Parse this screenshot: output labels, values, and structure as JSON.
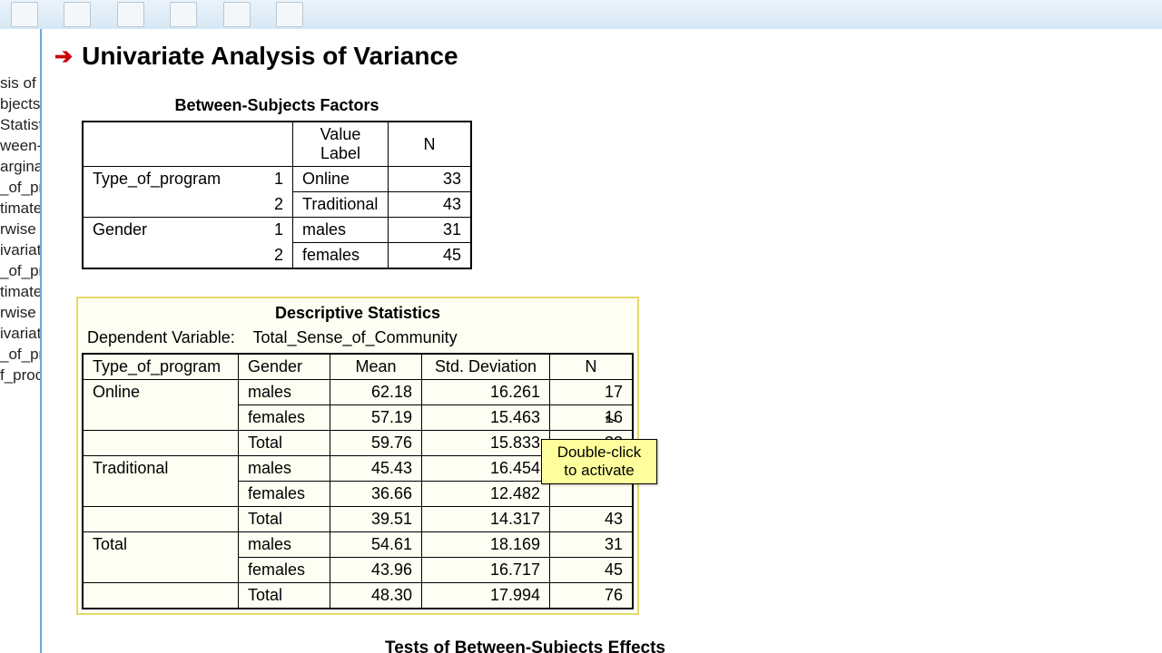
{
  "title": "Univariate Analysis of Variance",
  "outline_items": [
    "sis of V",
    "",
    "",
    "bjects",
    "Statisti",
    "ween-",
    "arginal",
    "",
    "_of_pr",
    "",
    "timate",
    "rwise",
    "ivariat",
    "_of_pr",
    "",
    "timate",
    "rwise",
    "ivariat",
    "_of_pr",
    "",
    "f_proc"
  ],
  "factors": {
    "caption": "Between-Subjects Factors",
    "headers": {
      "value_label": "Value Label",
      "n": "N"
    },
    "rows": [
      {
        "factor": "Type_of_program",
        "level": "1",
        "label": "Online",
        "n": "33"
      },
      {
        "factor": "",
        "level": "2",
        "label": "Traditional",
        "n": "43"
      },
      {
        "factor": "Gender",
        "level": "1",
        "label": "males",
        "n": "31"
      },
      {
        "factor": "",
        "level": "2",
        "label": "females",
        "n": "45"
      }
    ]
  },
  "descriptives": {
    "caption": "Descriptive Statistics",
    "dep_label": "Dependent Variable:",
    "dep_var": "Total_Sense_of_Community",
    "headers": {
      "c1": "Type_of_program",
      "c2": "Gender",
      "mean": "Mean",
      "sd": "Std. Deviation",
      "n": "N"
    },
    "rows": [
      {
        "c1": "Online",
        "c2": "males",
        "mean": "62.18",
        "sd": "16.261",
        "n": "17"
      },
      {
        "c1": "",
        "c2": "females",
        "mean": "57.19",
        "sd": "15.463",
        "n": "16"
      },
      {
        "c1": "",
        "c2": "Total",
        "mean": "59.76",
        "sd": "15.833",
        "n": "33"
      },
      {
        "c1": "Traditional",
        "c2": "males",
        "mean": "45.43",
        "sd": "16.454",
        "n": ""
      },
      {
        "c1": "",
        "c2": "females",
        "mean": "36.66",
        "sd": "12.482",
        "n": ""
      },
      {
        "c1": "",
        "c2": "Total",
        "mean": "39.51",
        "sd": "14.317",
        "n": "43"
      },
      {
        "c1": "Total",
        "c2": "males",
        "mean": "54.61",
        "sd": "18.169",
        "n": "31"
      },
      {
        "c1": "",
        "c2": "females",
        "mean": "43.96",
        "sd": "16.717",
        "n": "45"
      },
      {
        "c1": "",
        "c2": "Total",
        "mean": "48.30",
        "sd": "17.994",
        "n": "76"
      }
    ]
  },
  "tooltip": "Double-click to activate",
  "tests_caption": "Tests of Between-Subjects Effects"
}
